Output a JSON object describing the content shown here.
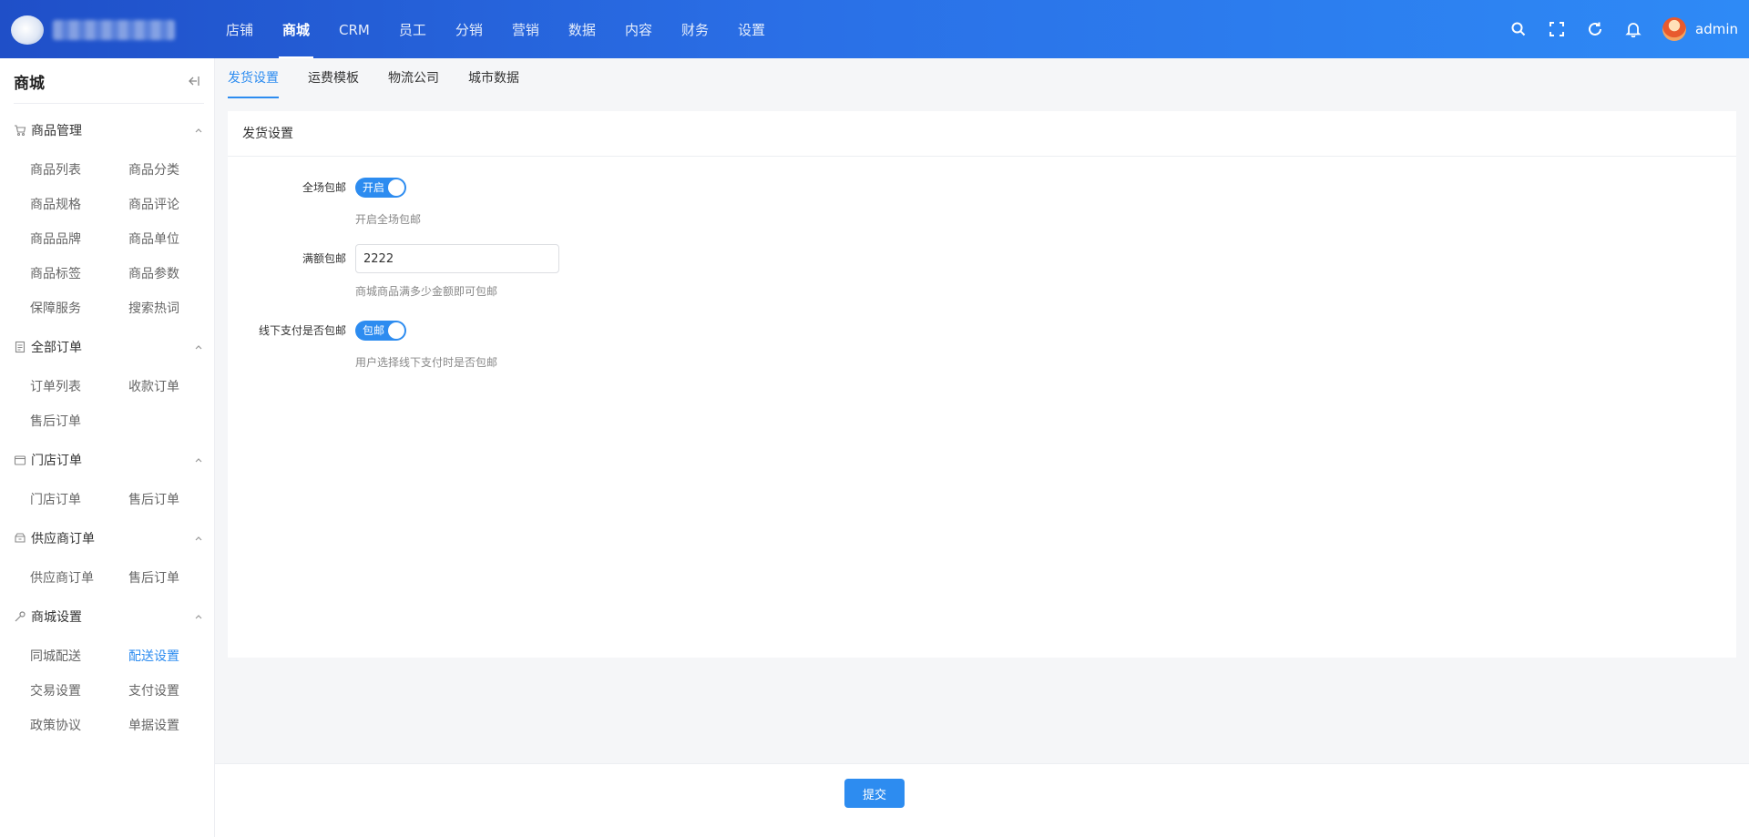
{
  "header": {
    "nav": [
      "店铺",
      "商城",
      "CRM",
      "员工",
      "分销",
      "营销",
      "数据",
      "内容",
      "财务",
      "设置"
    ],
    "active_nav": "商城",
    "icons": [
      "search-icon",
      "fullscreen-icon",
      "refresh-icon",
      "bell-icon"
    ],
    "user": "admin"
  },
  "sidebar": {
    "title": "商城",
    "groups": [
      {
        "title": "商品管理",
        "icon": "cart-icon",
        "items": [
          "商品列表",
          "商品分类",
          "商品规格",
          "商品评论",
          "商品品牌",
          "商品单位",
          "商品标签",
          "商品参数",
          "保障服务",
          "搜索热词"
        ]
      },
      {
        "title": "全部订单",
        "icon": "document-icon",
        "items": [
          "订单列表",
          "收款订单",
          "售后订单"
        ]
      },
      {
        "title": "门店订单",
        "icon": "shop-icon",
        "items": [
          "门店订单",
          "售后订单"
        ]
      },
      {
        "title": "供应商订单",
        "icon": "supplier-icon",
        "items": [
          "供应商订单",
          "售后订单"
        ]
      },
      {
        "title": "商城设置",
        "icon": "wrench-icon",
        "items": [
          "同城配送",
          "配送设置",
          "交易设置",
          "支付设置",
          "政策协议",
          "单据设置"
        ]
      }
    ],
    "active_item": "配送设置"
  },
  "tabs": [
    "发货设置",
    "运费模板",
    "物流公司",
    "城市数据"
  ],
  "active_tab": "发货设置",
  "card": {
    "title": "发货设置",
    "fields": {
      "free_shipping": {
        "label": "全场包邮",
        "switch_text": "开启",
        "hint": "开启全场包邮",
        "on": true
      },
      "threshold": {
        "label": "满额包邮",
        "value": "2222",
        "hint": "商城商品满多少金额即可包邮"
      },
      "offline": {
        "label": "线下支付是否包邮",
        "switch_text": "包邮",
        "hint": "用户选择线下支付时是否包邮",
        "on": true
      }
    }
  },
  "footer": {
    "submit_label": "提交"
  },
  "colors": {
    "primary": "#2d8cf0",
    "header_start": "#1f4fc8",
    "header_end": "#2e8af6"
  }
}
